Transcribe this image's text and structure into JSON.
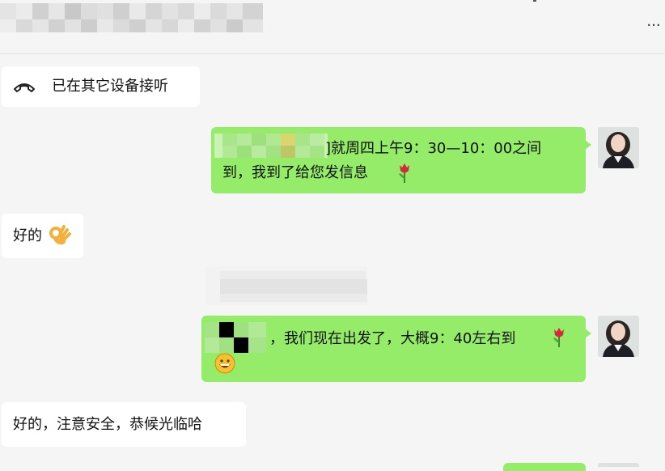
{
  "header": {
    "more_label": "···"
  },
  "messages": {
    "call_notice": "已在其它设备接听",
    "msg1_line1": "]就周四上午9：30—10：00之间",
    "msg1_line2": "到，我到了给您发信息",
    "reply1": "好的",
    "msg2_line1": "，我们现在出发了，大概9：40左右到",
    "reply2": "好的，注意安全，恭候光临哈"
  },
  "icons": {
    "phone": "phone-hangup-icon",
    "tulip": "tulip-emoji-icon",
    "ok_hand": "ok-hand-emoji-icon",
    "grin": "grinning-emoji-icon",
    "more": "more-dots-icon"
  },
  "colors": {
    "sent_bubble": "#95ec69",
    "received_bubble": "#ffffff",
    "background": "#f5f5f5"
  }
}
